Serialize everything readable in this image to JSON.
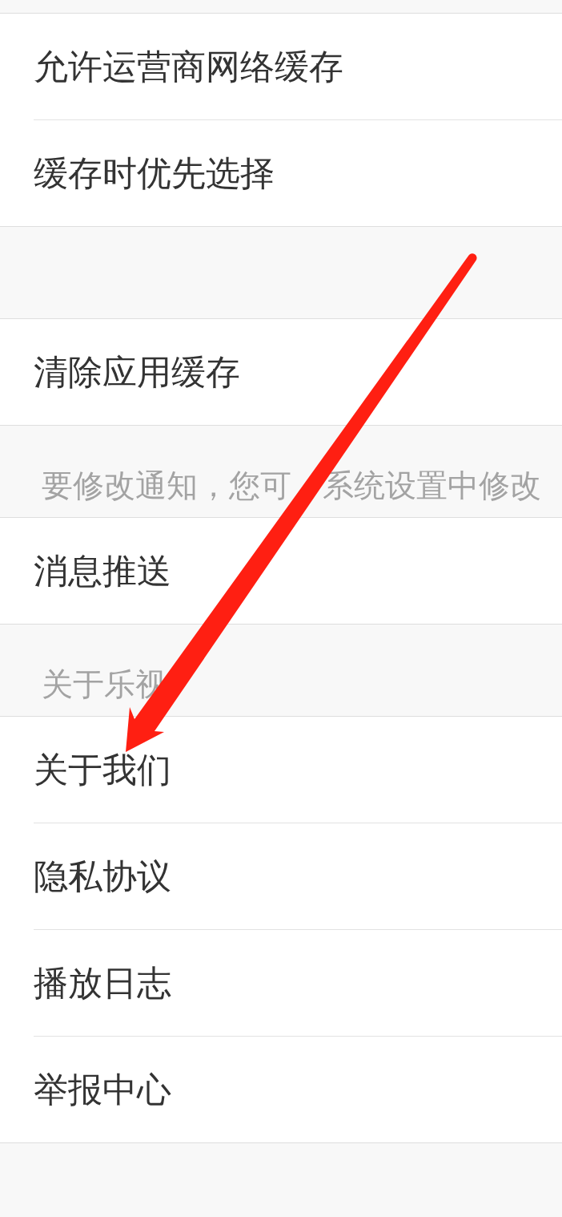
{
  "sections": [
    {
      "items": [
        "允许运营商网络缓存",
        "缓存时优先选择"
      ]
    },
    {
      "items": [
        "清除应用缓存"
      ]
    },
    {
      "header": [
        "要修改通知，您可",
        "系统设置中修改"
      ],
      "items": [
        "消息推送"
      ]
    },
    {
      "header": [
        "关于乐视"
      ],
      "items": [
        "关于我们",
        "隐私协议",
        "播放日志",
        "举报中心"
      ]
    }
  ],
  "annotations": [
    {
      "kind": "arrow"
    }
  ]
}
